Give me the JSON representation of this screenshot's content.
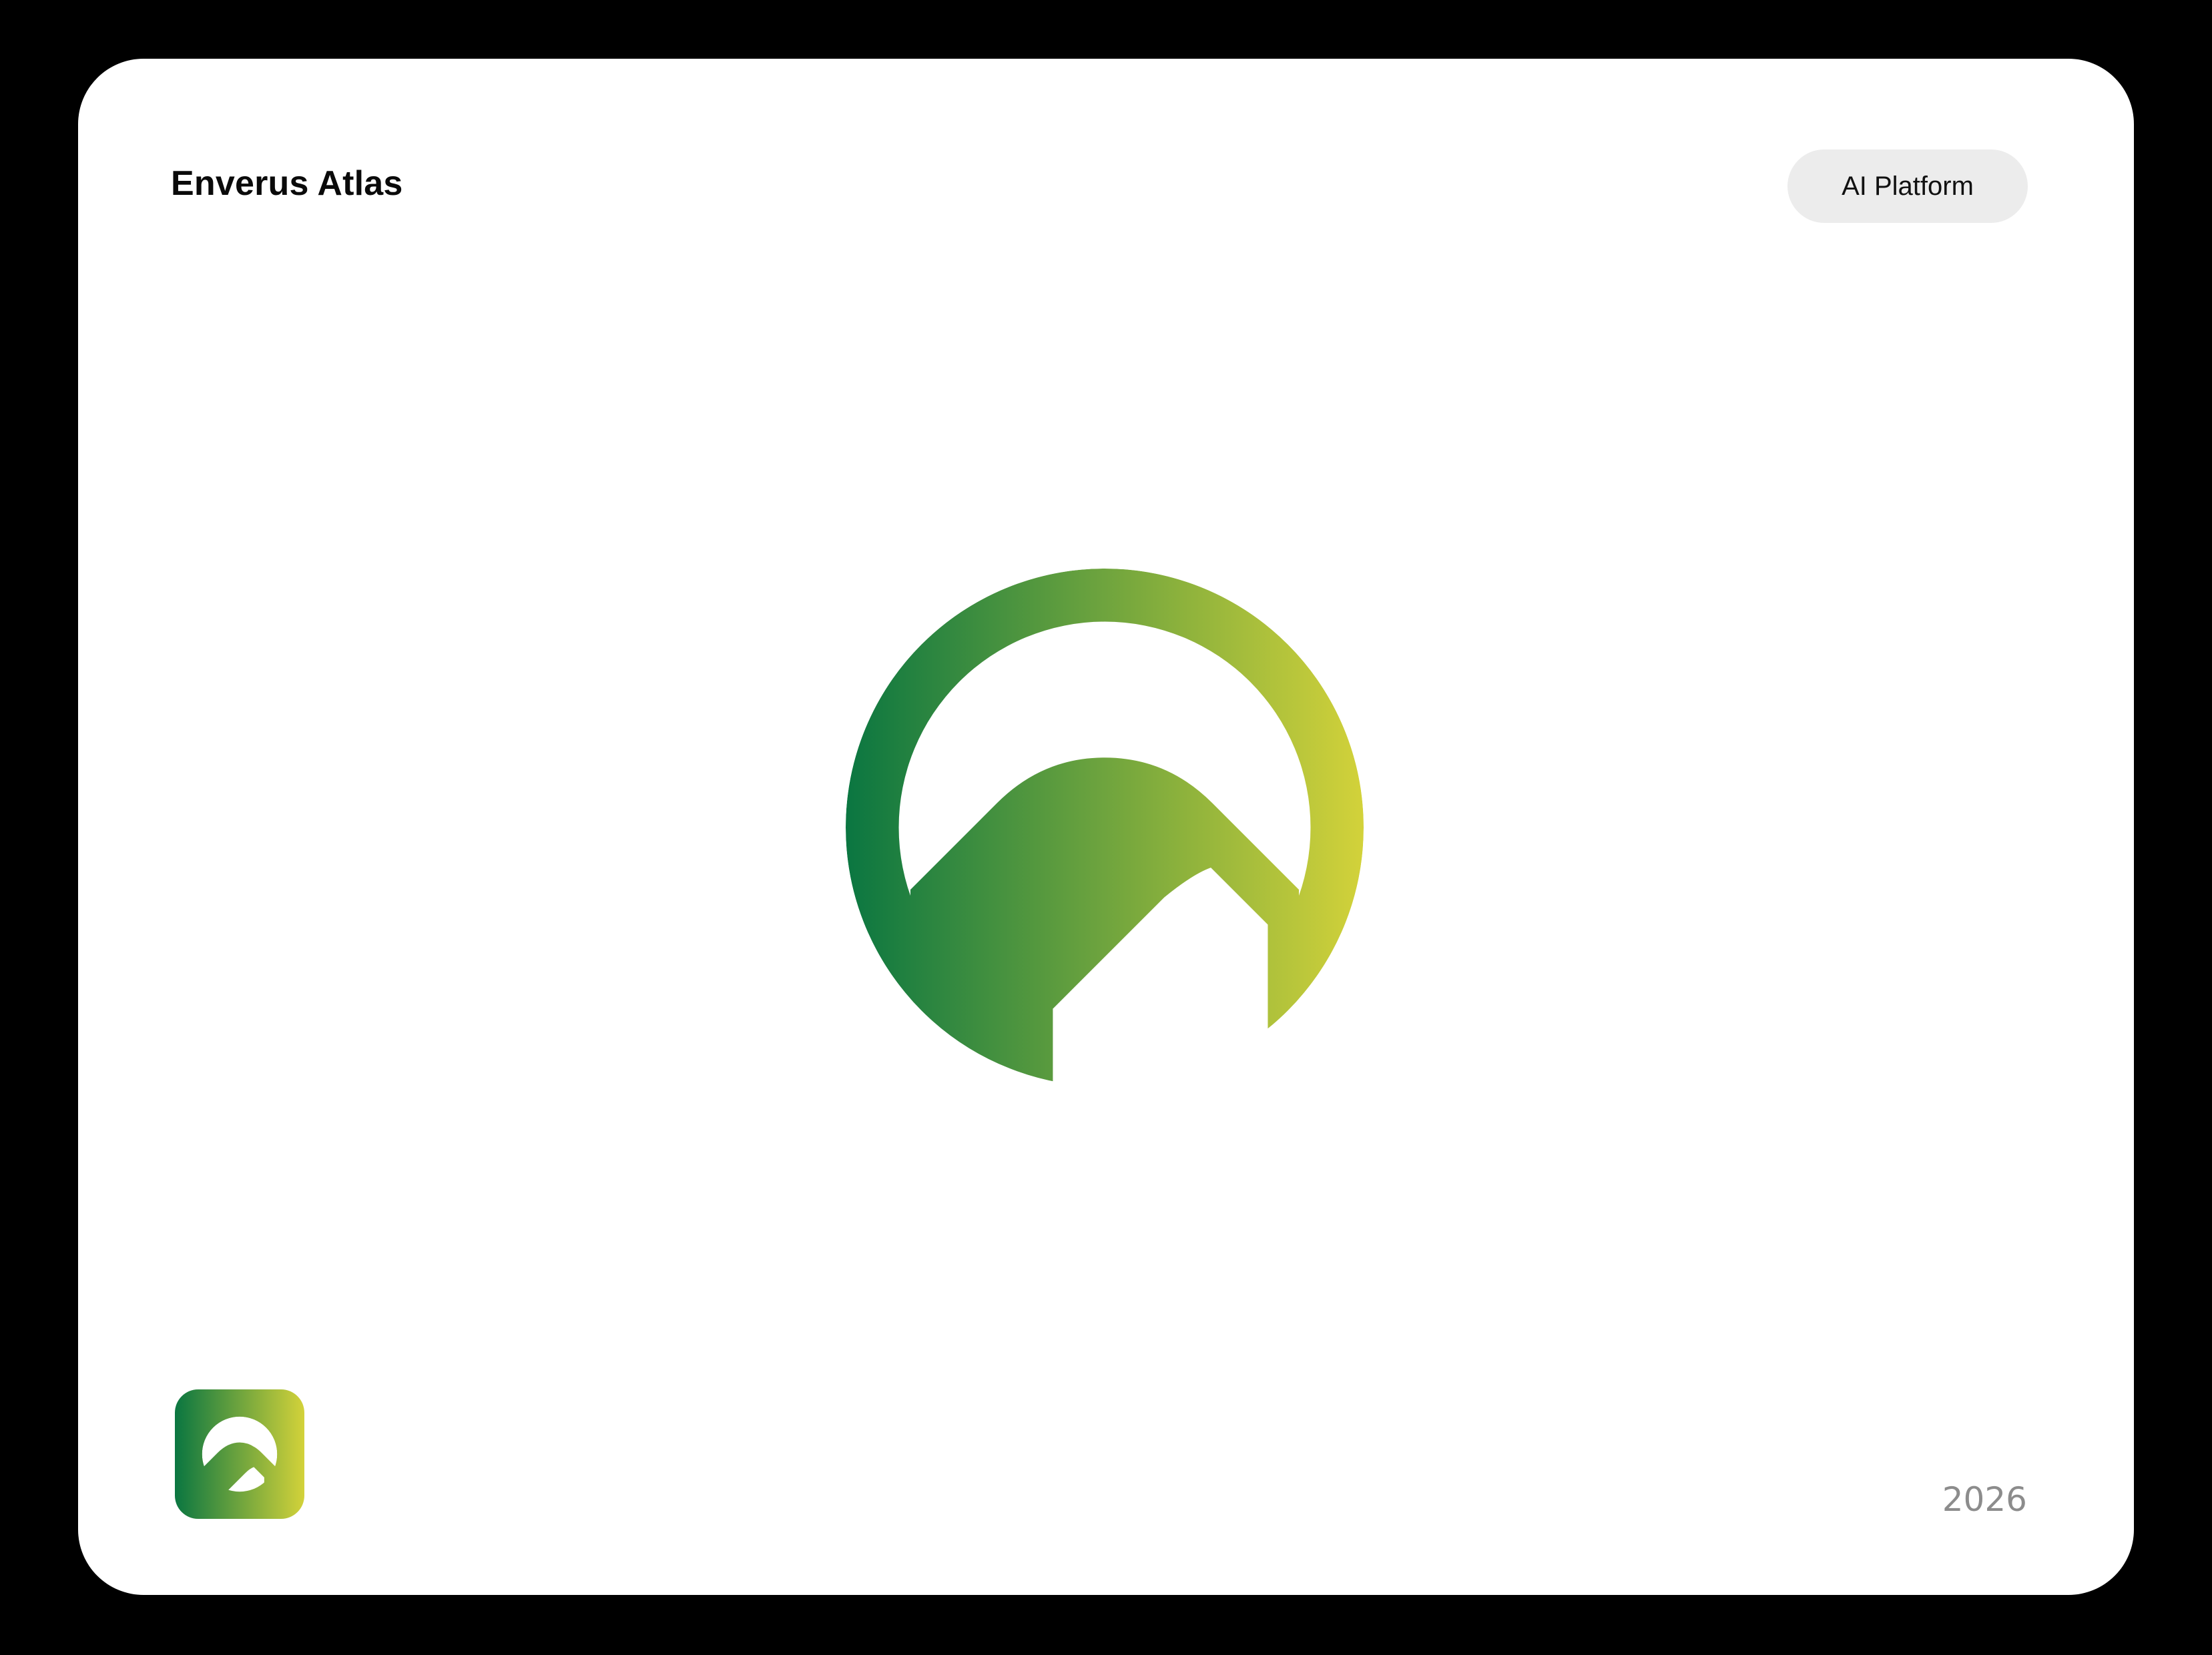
{
  "header": {
    "brand_name": "Enverus Atlas",
    "badge_label": "AI Platform"
  },
  "footer": {
    "year": "2026"
  },
  "logo": {
    "gradient_start": "#0a7641",
    "gradient_end": "#d3d23a",
    "icon_name": "atlas-mountain-circle-icon"
  },
  "colors": {
    "background": "#000000",
    "card": "#ffffff",
    "badge_background": "#ececec",
    "year_text": "#8c8c8c"
  }
}
